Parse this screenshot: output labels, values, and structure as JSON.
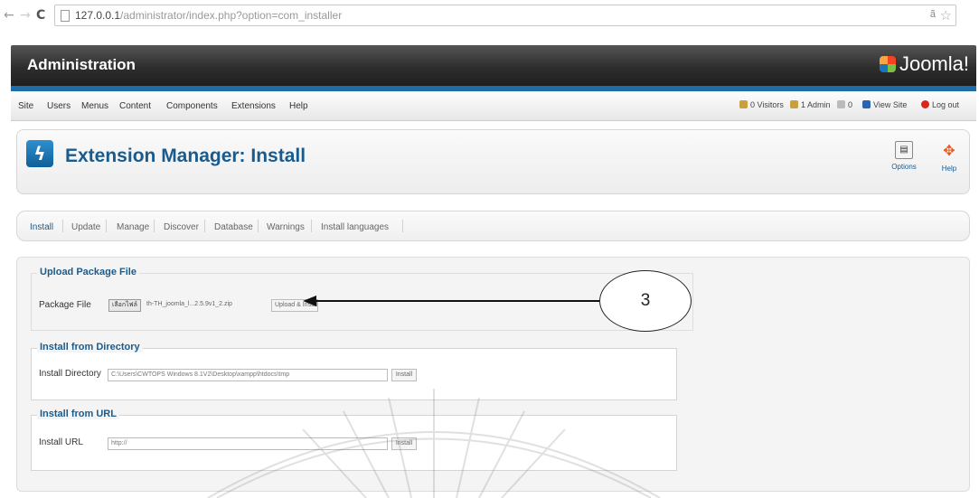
{
  "browser": {
    "url_host": "127.0.0.1",
    "url_path": "/administrator/index.php?option=com_installer"
  },
  "header": {
    "title": "Administration",
    "logo_text": "Joomla!"
  },
  "menu": {
    "items": [
      "Site",
      "Users",
      "Menus",
      "Content",
      "Components",
      "Extensions",
      "Help"
    ],
    "status": {
      "visitors": "0 Visitors",
      "admin": "1 Admin",
      "messages": "0",
      "view_site": "View Site",
      "logout": "Log out"
    }
  },
  "page": {
    "title": "Extension Manager: Install",
    "toolbar": {
      "options": "Options",
      "help": "Help"
    }
  },
  "tabs": [
    "Install",
    "Update",
    "Manage",
    "Discover",
    "Database",
    "Warnings",
    "Install languages"
  ],
  "install": {
    "upload": {
      "legend": "Upload Package File",
      "label": "Package File",
      "browse_btn": "เลือกไฟล์",
      "file_name": "th-TH_joomla_l...2.5.9v1_2.zip",
      "button": "Upload & Install"
    },
    "directory": {
      "legend": "Install from Directory",
      "label": "Install Directory",
      "value": "C:\\Users\\CWTOPS Windows 8.1V2\\Desktop\\xampp\\htdocs\\tmp",
      "button": "Install"
    },
    "url": {
      "legend": "Install from URL",
      "label": "Install URL",
      "value": "http://",
      "button": "Install"
    }
  },
  "annotation": {
    "number": "3"
  }
}
